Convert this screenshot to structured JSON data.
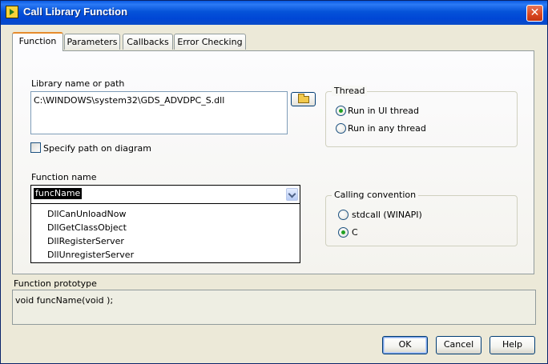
{
  "window": {
    "title": "Call Library Function",
    "close_label": "✕"
  },
  "tabs": [
    {
      "label": "Function",
      "active": true
    },
    {
      "label": "Parameters",
      "active": false
    },
    {
      "label": "Callbacks",
      "active": false
    },
    {
      "label": "Error Checking",
      "active": false
    }
  ],
  "library": {
    "label": "Library name or path",
    "value": "C:\\WINDOWS\\system32\\GDS_ADVDPC_S.dll",
    "browse_icon": "folder-open-icon",
    "specify_path_label": "Specify path on diagram",
    "specify_path_checked": false
  },
  "thread": {
    "title": "Thread",
    "options": [
      "Run in UI thread",
      "Run in any thread"
    ],
    "selected": "Run in UI thread"
  },
  "function": {
    "label": "Function name",
    "value": "funcName",
    "options": [
      "DllCanUnloadNow",
      "DllGetClassObject",
      "DllRegisterServer",
      "DllUnregisterServer"
    ]
  },
  "calling_convention": {
    "title": "Calling convention",
    "options": [
      "stdcall (WINAPI)",
      "C"
    ],
    "selected": "C"
  },
  "prototype": {
    "label": "Function prototype",
    "value": "void  funcName(void );"
  },
  "buttons": {
    "ok": "OK",
    "cancel": "Cancel",
    "help": "Help"
  },
  "colors": {
    "titlebar": "#0054e3",
    "tab_accent": "#e68b2c",
    "radio_selected": "#21a121",
    "close_button": "#d8451f"
  }
}
